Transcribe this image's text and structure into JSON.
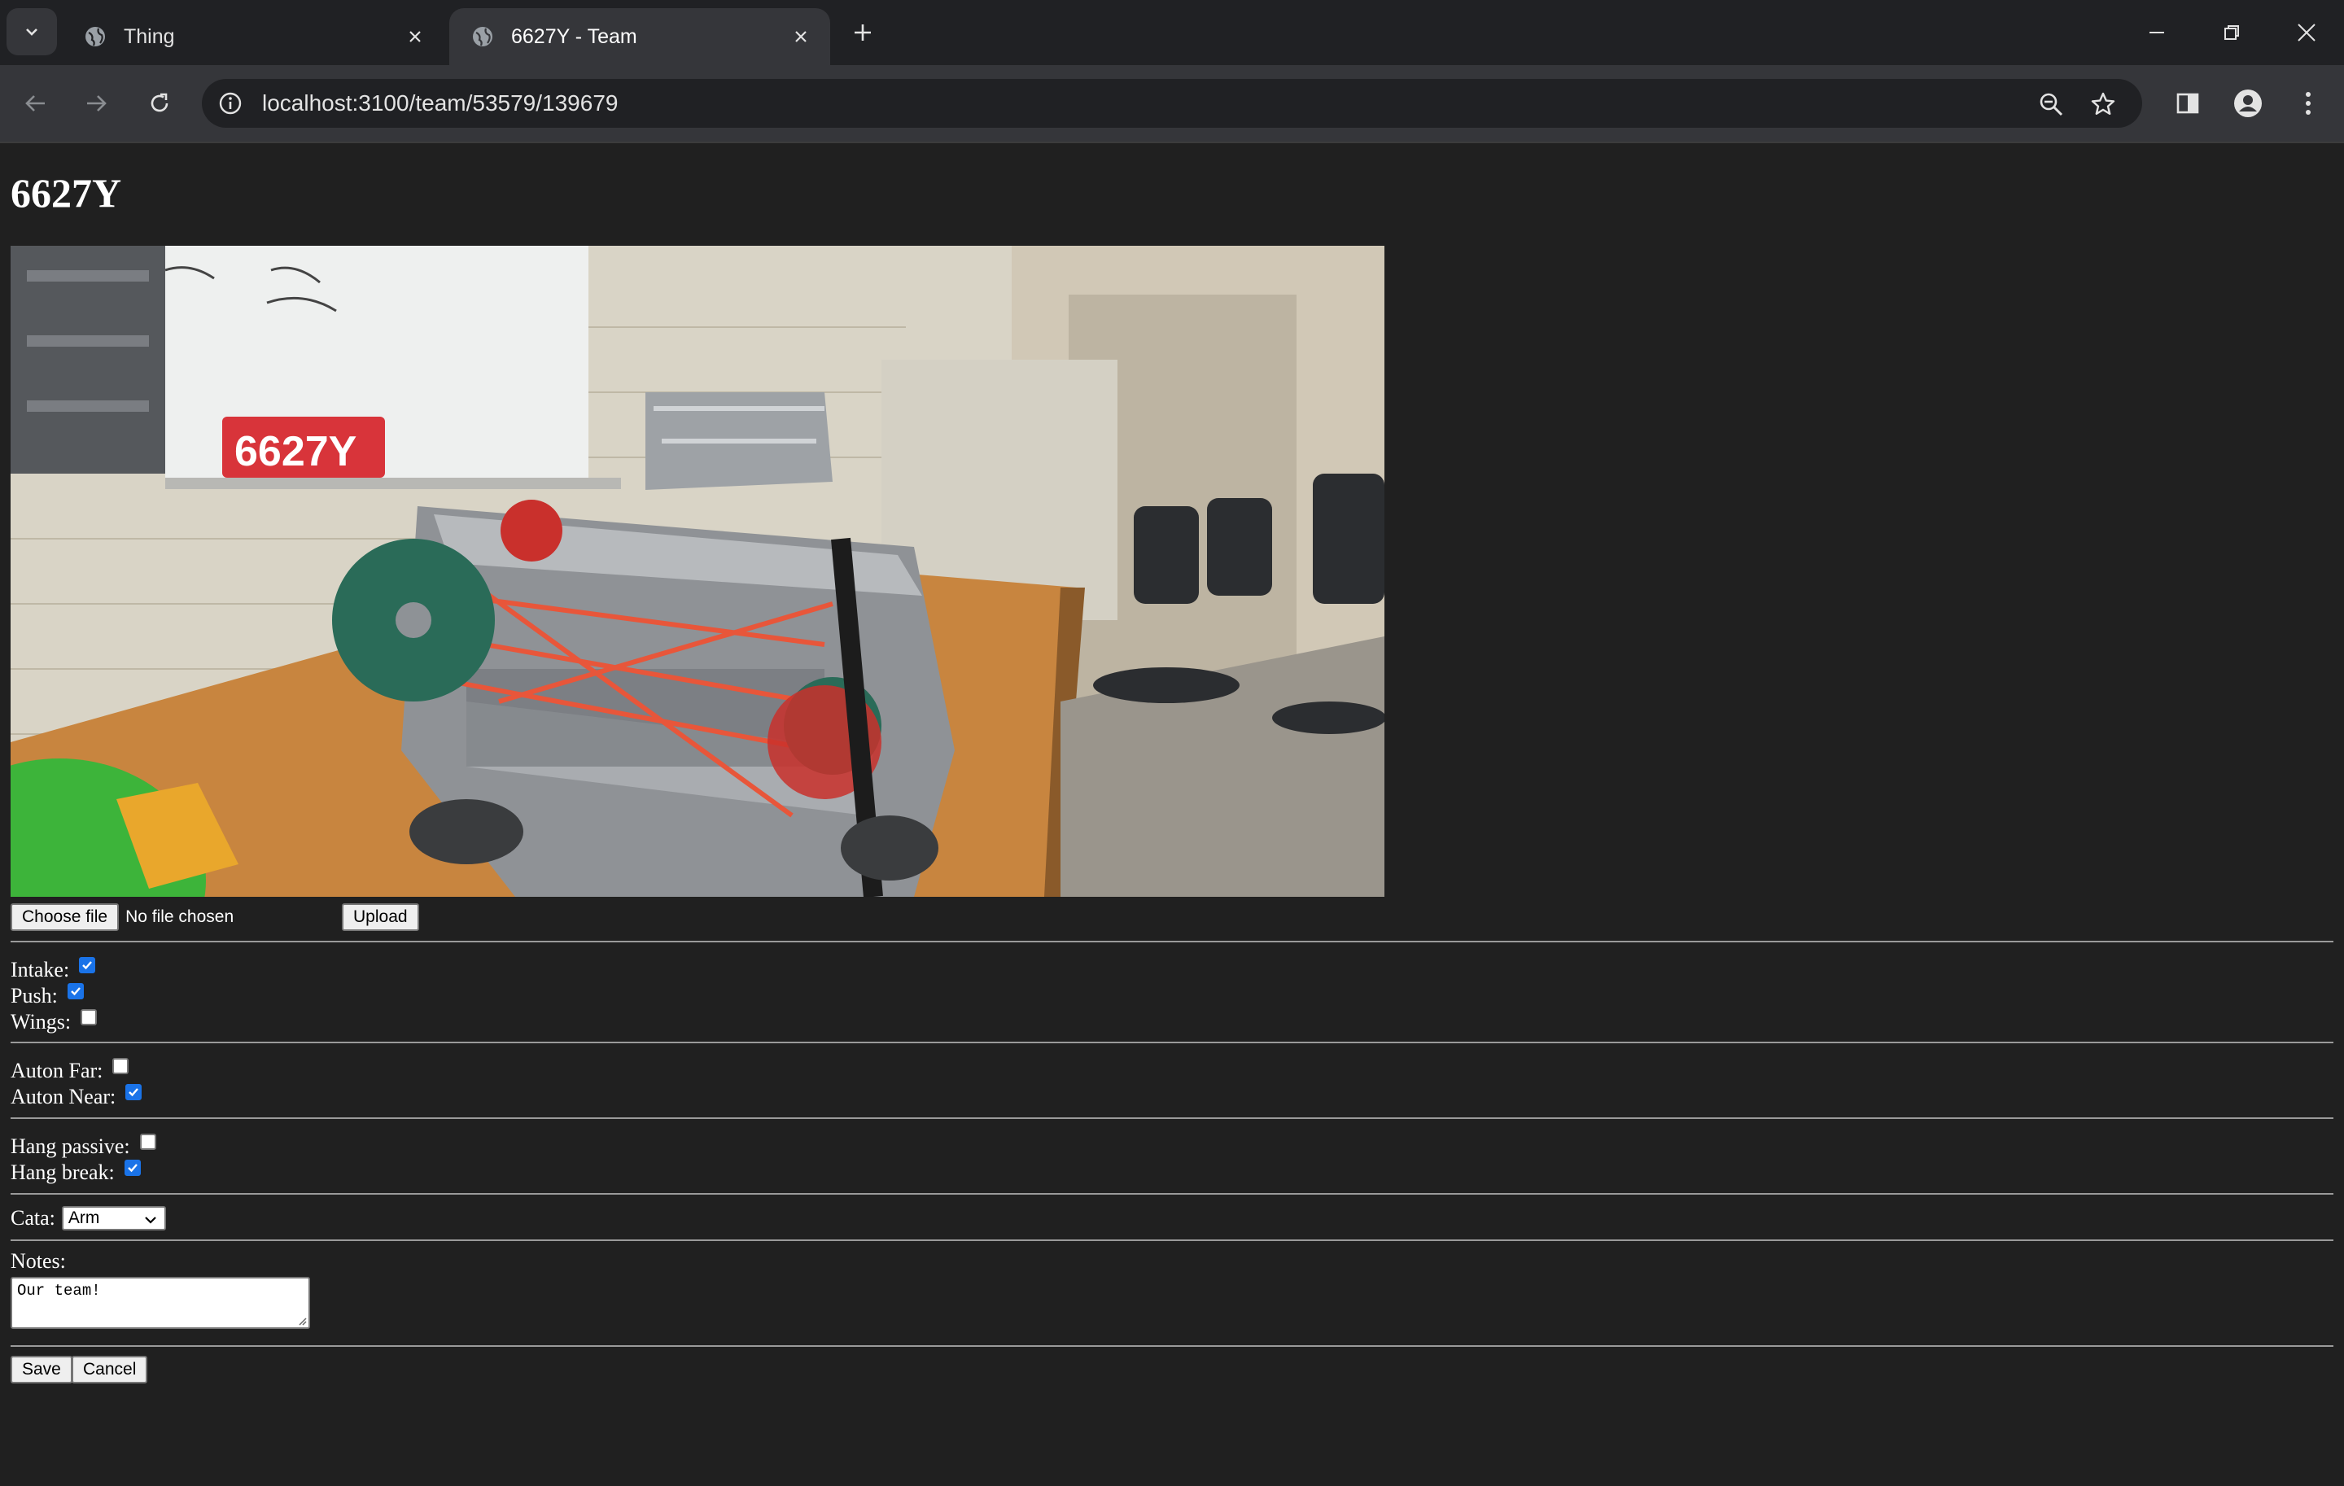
{
  "browser": {
    "tabs": [
      {
        "title": "Thing",
        "active": false
      },
      {
        "title": "6627Y - Team",
        "active": true
      }
    ],
    "url": "localhost:3100/team/53579/139679"
  },
  "page": {
    "title": "6627Y",
    "photo_alt": "Team robot photo",
    "file_input": {
      "button_label": "Choose file",
      "status": "No file chosen"
    },
    "upload_label": "Upload",
    "capabilities": [
      {
        "label": "Intake:",
        "checked": true
      },
      {
        "label": "Push:",
        "checked": true
      },
      {
        "label": "Wings:",
        "checked": false
      }
    ],
    "auton": [
      {
        "label": "Auton Far:",
        "checked": false
      },
      {
        "label": "Auton Near:",
        "checked": true
      }
    ],
    "hang": [
      {
        "label": "Hang passive:",
        "checked": false
      },
      {
        "label": "Hang break:",
        "checked": true
      }
    ],
    "cata": {
      "label": "Cata:",
      "selected": "Arm"
    },
    "notes": {
      "label": "Notes:",
      "value": "Our team!"
    },
    "save_label": "Save",
    "cancel_label": "Cancel"
  },
  "colors": {
    "page_bg": "#202020",
    "checkbox_checked": "#1a73e8"
  },
  "icons": {
    "tab_search": "chevron-down-icon",
    "favicon": "globe-icon",
    "tab_close": "close-icon",
    "new_tab": "plus-icon",
    "back": "arrow-left-icon",
    "forward": "arrow-right-icon",
    "reload": "reload-icon",
    "site_info": "info-icon",
    "zoom": "zoom-out-icon",
    "bookmark": "star-icon",
    "side_panel": "side-panel-icon",
    "profile": "profile-icon",
    "menu": "kebab-menu-icon"
  }
}
